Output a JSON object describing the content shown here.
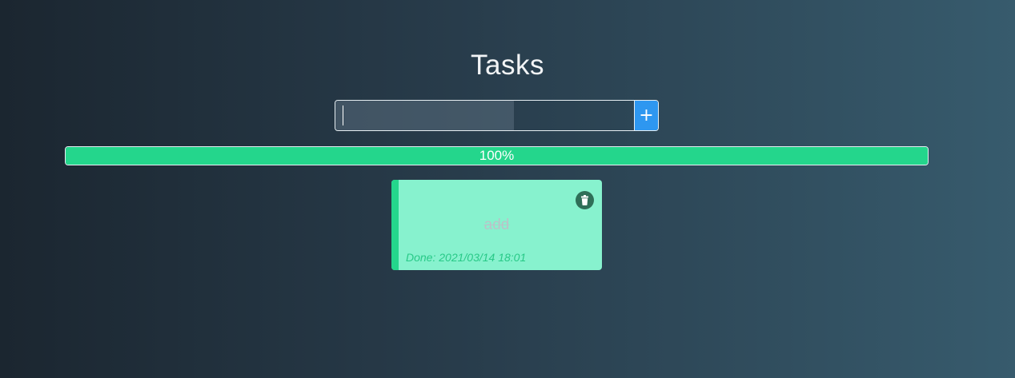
{
  "header": {
    "title": "Tasks"
  },
  "add_form": {
    "input_value": "",
    "add_label": "+"
  },
  "progress": {
    "percent": 100,
    "label": "100%"
  },
  "tasks": [
    {
      "text": "add",
      "done_text": "Done: 2021/03/14 18:01",
      "completed": true,
      "delete_icon": "trash-icon"
    }
  ],
  "colors": {
    "accent_green": "#24d68c",
    "card_green": "#87f2ce",
    "add_blue": "#2e97f0"
  }
}
